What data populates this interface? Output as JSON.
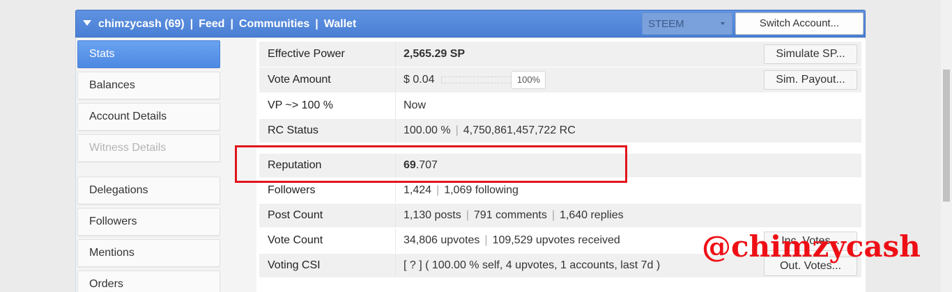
{
  "header": {
    "account": "chimzycash (69)",
    "nav": [
      "Feed",
      "Communities",
      "Wallet"
    ],
    "chain_select": "STEEM",
    "switch_account_label": "Switch Account..."
  },
  "sidebar": {
    "items": [
      {
        "label": "Stats",
        "state": "active"
      },
      {
        "label": "Balances",
        "state": "normal"
      },
      {
        "label": "Account Details",
        "state": "normal"
      },
      {
        "label": "Witness Details",
        "state": "disabled"
      },
      {
        "label": "Delegations",
        "state": "normal"
      },
      {
        "label": "Followers",
        "state": "normal"
      },
      {
        "label": "Mentions",
        "state": "normal"
      },
      {
        "label": "Orders",
        "state": "normal"
      }
    ]
  },
  "stats": {
    "effective_power": {
      "label": "Effective Power",
      "value": "2,565.29 SP",
      "button": "Simulate SP..."
    },
    "vote_amount": {
      "label": "Vote Amount",
      "value": "$ 0.04",
      "slider_label": "100%",
      "slider_percent": 100,
      "button": "Sim. Payout..."
    },
    "vp": {
      "label": "VP ~> 100 %",
      "value": "Now"
    },
    "rc_status": {
      "label": "RC Status",
      "percent": "100.00 %",
      "rc": "4,750,861,457,722 RC"
    },
    "reputation": {
      "label": "Reputation",
      "int": "69",
      "decimal": ".707"
    },
    "followers": {
      "label": "Followers",
      "count": "1,424",
      "following": "1,069 following"
    },
    "post_count": {
      "label": "Post Count",
      "posts": "1,130 posts",
      "comments": "791 comments",
      "replies": "1,640 replies"
    },
    "vote_count": {
      "label": "Vote Count",
      "upvotes": "34,806 upvotes",
      "received": "109,529 upvotes received",
      "button": "Inc. Votes..."
    },
    "voting_csi": {
      "label": "Voting CSI",
      "value": "[ ? ] ( 100.00 % self, 4 upvotes, 1 accounts, last 7d )",
      "button": "Out. Votes..."
    }
  },
  "watermark": "@chimzycash",
  "colors": {
    "accent": "#4d88e2",
    "highlight": "#e0151b",
    "watermark": "#ee0f16"
  }
}
